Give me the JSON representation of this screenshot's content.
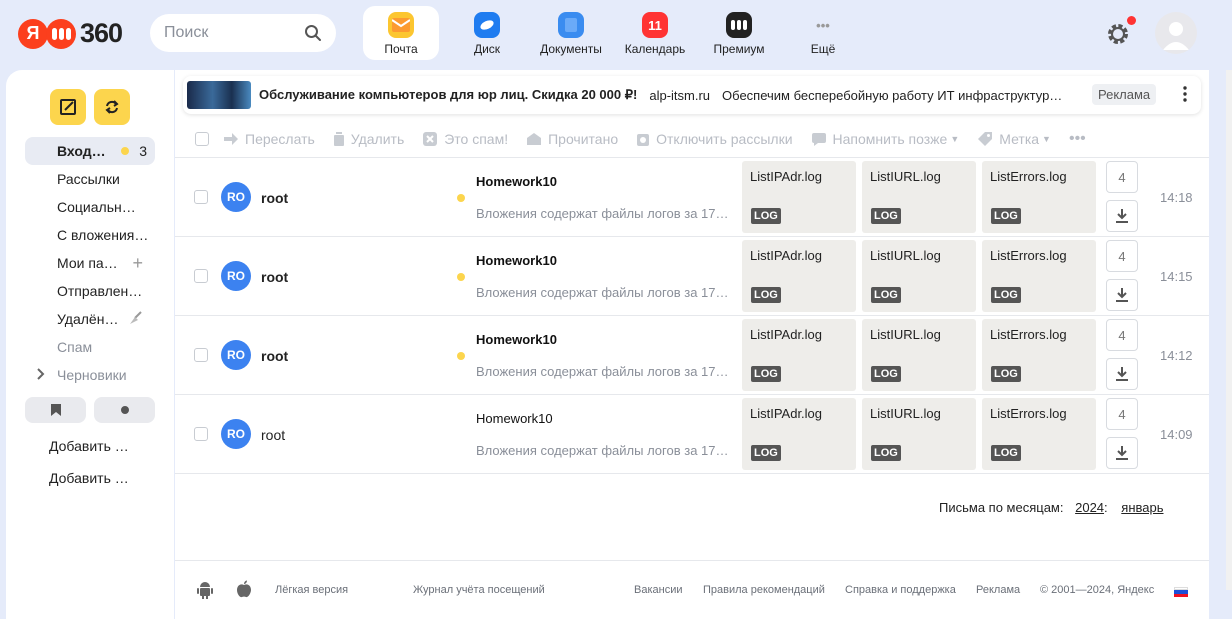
{
  "header": {
    "logo_letter": "Я",
    "logo_number": "360",
    "search_placeholder": "Поиск",
    "apps": [
      {
        "label": "Почта",
        "icon": "mail-icon",
        "color": "#fcc630"
      },
      {
        "label": "Диск",
        "icon": "disk-icon",
        "color": "#1f7cf0"
      },
      {
        "label": "Документы",
        "icon": "documents-icon",
        "color": "#3a8cf0"
      },
      {
        "label": "Календарь",
        "icon": "calendar-icon",
        "color": "#f33",
        "badge": "11"
      },
      {
        "label": "Премиум",
        "icon": "premium-icon",
        "color": "#222"
      },
      {
        "label": "Ещё",
        "icon": "more-icon",
        "color": "#999"
      }
    ]
  },
  "sidebar": {
    "folders": [
      {
        "label": "Вход…",
        "count": "3"
      },
      {
        "label": "Рассылки"
      },
      {
        "label": "Социальн…"
      },
      {
        "label": "С вложения…"
      },
      {
        "label": "Мои па…"
      },
      {
        "label": "Отправлен…"
      },
      {
        "label": "Удалён…"
      },
      {
        "label": "Спам"
      },
      {
        "label": "Черновики"
      }
    ],
    "add_links": [
      "Добавить …",
      "Добавить …"
    ]
  },
  "ad": {
    "title": "Обслуживание компьютеров для юр лиц. Скидка 20 000 ₽!",
    "domain": "alp-itsm.ru",
    "description": "Обеспечим бесперебойную работу ИТ инфраструктур…",
    "badge": "Реклама"
  },
  "toolbar": {
    "forward": "Переслать",
    "delete": "Удалить",
    "spam": "Это спам!",
    "read": "Прочитано",
    "unsubscribe": "Отключить рассылки",
    "remind": "Напомнить позже",
    "label": "Метка"
  },
  "messages": [
    {
      "avatar": "RO",
      "sender": "root",
      "subject": "Homework10",
      "snippet": "Вложения содержат файлы логов за 17…",
      "attachments": [
        "ListIPAdr.log",
        "ListIURL.log",
        "ListErrors.log"
      ],
      "tag": "LOG",
      "count": "4",
      "time": "14:18",
      "unread": true
    },
    {
      "avatar": "RO",
      "sender": "root",
      "subject": "Homework10",
      "snippet": "Вложения содержат файлы логов за 17…",
      "attachments": [
        "ListIPAdr.log",
        "ListIURL.log",
        "ListErrors.log"
      ],
      "tag": "LOG",
      "count": "4",
      "time": "14:15",
      "unread": true
    },
    {
      "avatar": "RO",
      "sender": "root",
      "subject": "Homework10",
      "snippet": "Вложения содержат файлы логов за 17…",
      "attachments": [
        "ListIPAdr.log",
        "ListIURL.log",
        "ListErrors.log"
      ],
      "tag": "LOG",
      "count": "4",
      "time": "14:12",
      "unread": true
    },
    {
      "avatar": "RO",
      "sender": "root",
      "subject": "Homework10",
      "snippet": "Вложения содержат файлы логов за 17…",
      "attachments": [
        "ListIPAdr.log",
        "ListIURL.log",
        "ListErrors.log"
      ],
      "tag": "LOG",
      "count": "4",
      "time": "14:09",
      "unread": false
    }
  ],
  "months": {
    "label": "Письма по месяцам:",
    "year": "2024",
    "month": "январь"
  },
  "footer": {
    "light": "Лёгкая версия",
    "journal": "Журнал учёта посещений",
    "jobs": "Вакансии",
    "rules": "Правила рекомендаций",
    "help": "Справка и поддержка",
    "ads": "Реклама",
    "copyright": "© 2001—2024, Яндекс"
  }
}
